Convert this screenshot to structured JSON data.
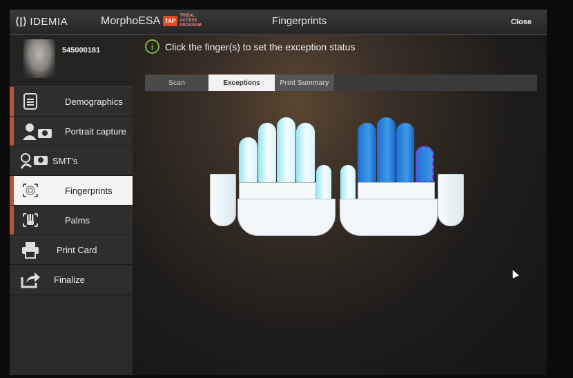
{
  "header": {
    "brand": "IDEMIA",
    "app_name": "MorphoESA",
    "tap_badge": "TAP",
    "tap_text": "TRIBAL ACCESS PROGRAM",
    "title": "Fingerprints",
    "close_label": "Close"
  },
  "user": {
    "id": "545000181"
  },
  "nav": {
    "demographics": "Demographics",
    "portrait": "Portrait capture",
    "smt": "SMT's",
    "fingerprints": "Fingerprints",
    "palms": "Palms",
    "print_card": "Print Card",
    "finalize": "Finalize"
  },
  "instruction": "Click the finger(s) to set the exception status",
  "tabs": {
    "scan": "Scan",
    "exceptions": "Exceptions",
    "print_summary": "Print Summary"
  },
  "colors": {
    "accent_stripe": "#b7553a",
    "info_green": "#7ab94a",
    "finger_selected": "#2f86dc",
    "finger_default": "#d6f4fa",
    "exception_outline": "#6f43d8"
  }
}
